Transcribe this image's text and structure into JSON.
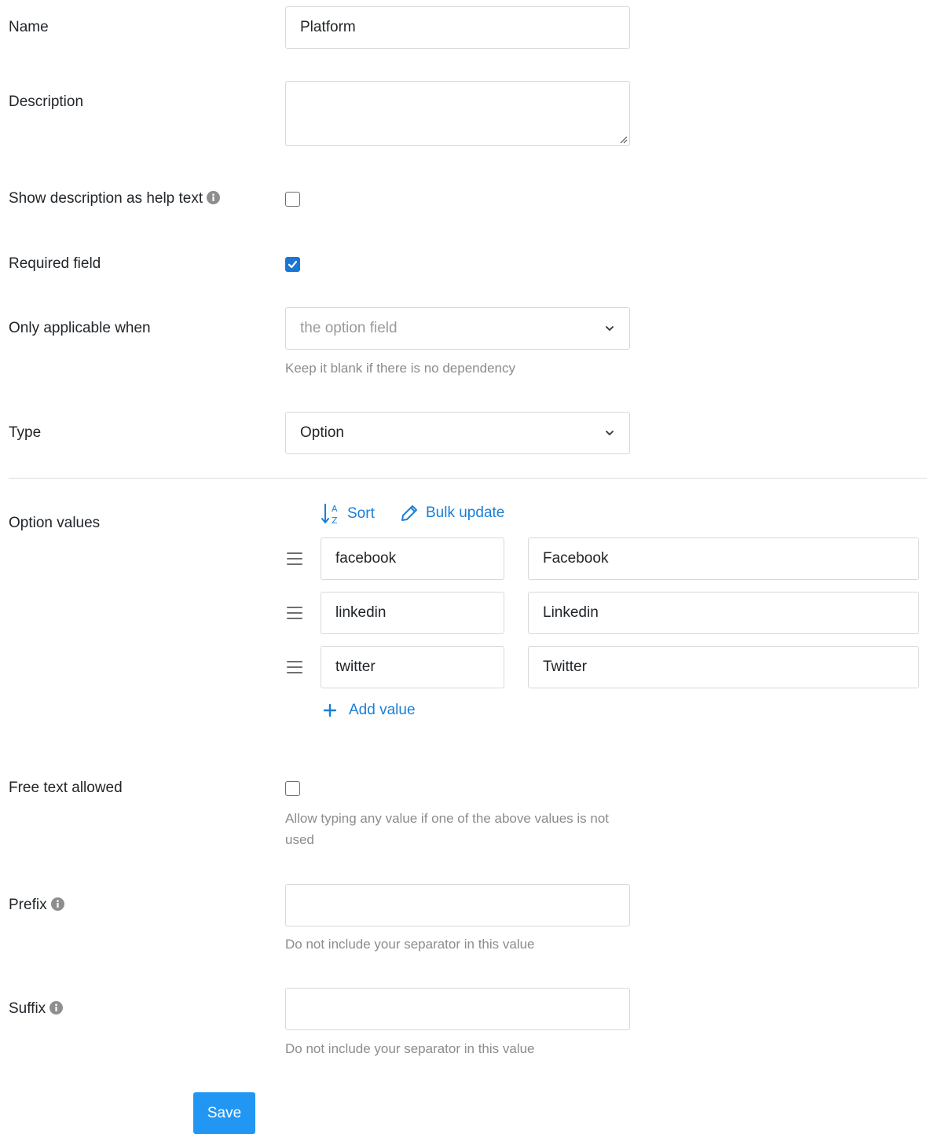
{
  "form": {
    "name": {
      "label": "Name",
      "value": "Platform"
    },
    "description": {
      "label": "Description",
      "value": ""
    },
    "show_help": {
      "label": "Show description as help text",
      "checked": false
    },
    "required": {
      "label": "Required field",
      "checked": true
    },
    "applicable": {
      "label": "Only applicable when",
      "placeholder": "the option field",
      "help": "Keep it blank if there is no dependency"
    },
    "type": {
      "label": "Type",
      "value": "Option"
    },
    "option_values": {
      "label": "Option values",
      "sort_label": "Sort",
      "bulk_label": "Bulk update",
      "add_label": "Add value",
      "rows": [
        {
          "key": "facebook",
          "value": "Facebook"
        },
        {
          "key": "linkedin",
          "value": "Linkedin"
        },
        {
          "key": "twitter",
          "value": "Twitter"
        }
      ]
    },
    "free_text": {
      "label": "Free text allowed",
      "checked": false,
      "help": "Allow typing any value if one of the above values is not used"
    },
    "prefix": {
      "label": "Prefix",
      "value": "",
      "help": "Do not include your separator in this value"
    },
    "suffix": {
      "label": "Suffix",
      "value": "",
      "help": "Do not include your separator in this value"
    },
    "save_label": "Save"
  },
  "colors": {
    "accent": "#1a7fd6",
    "primary_button": "#2196f3",
    "checkbox_checked": "#1976d2"
  },
  "icons": [
    "info-icon",
    "chevron-down-icon",
    "sort-az-icon",
    "pencil-icon",
    "drag-handle-icon",
    "plus-icon",
    "check-icon"
  ]
}
